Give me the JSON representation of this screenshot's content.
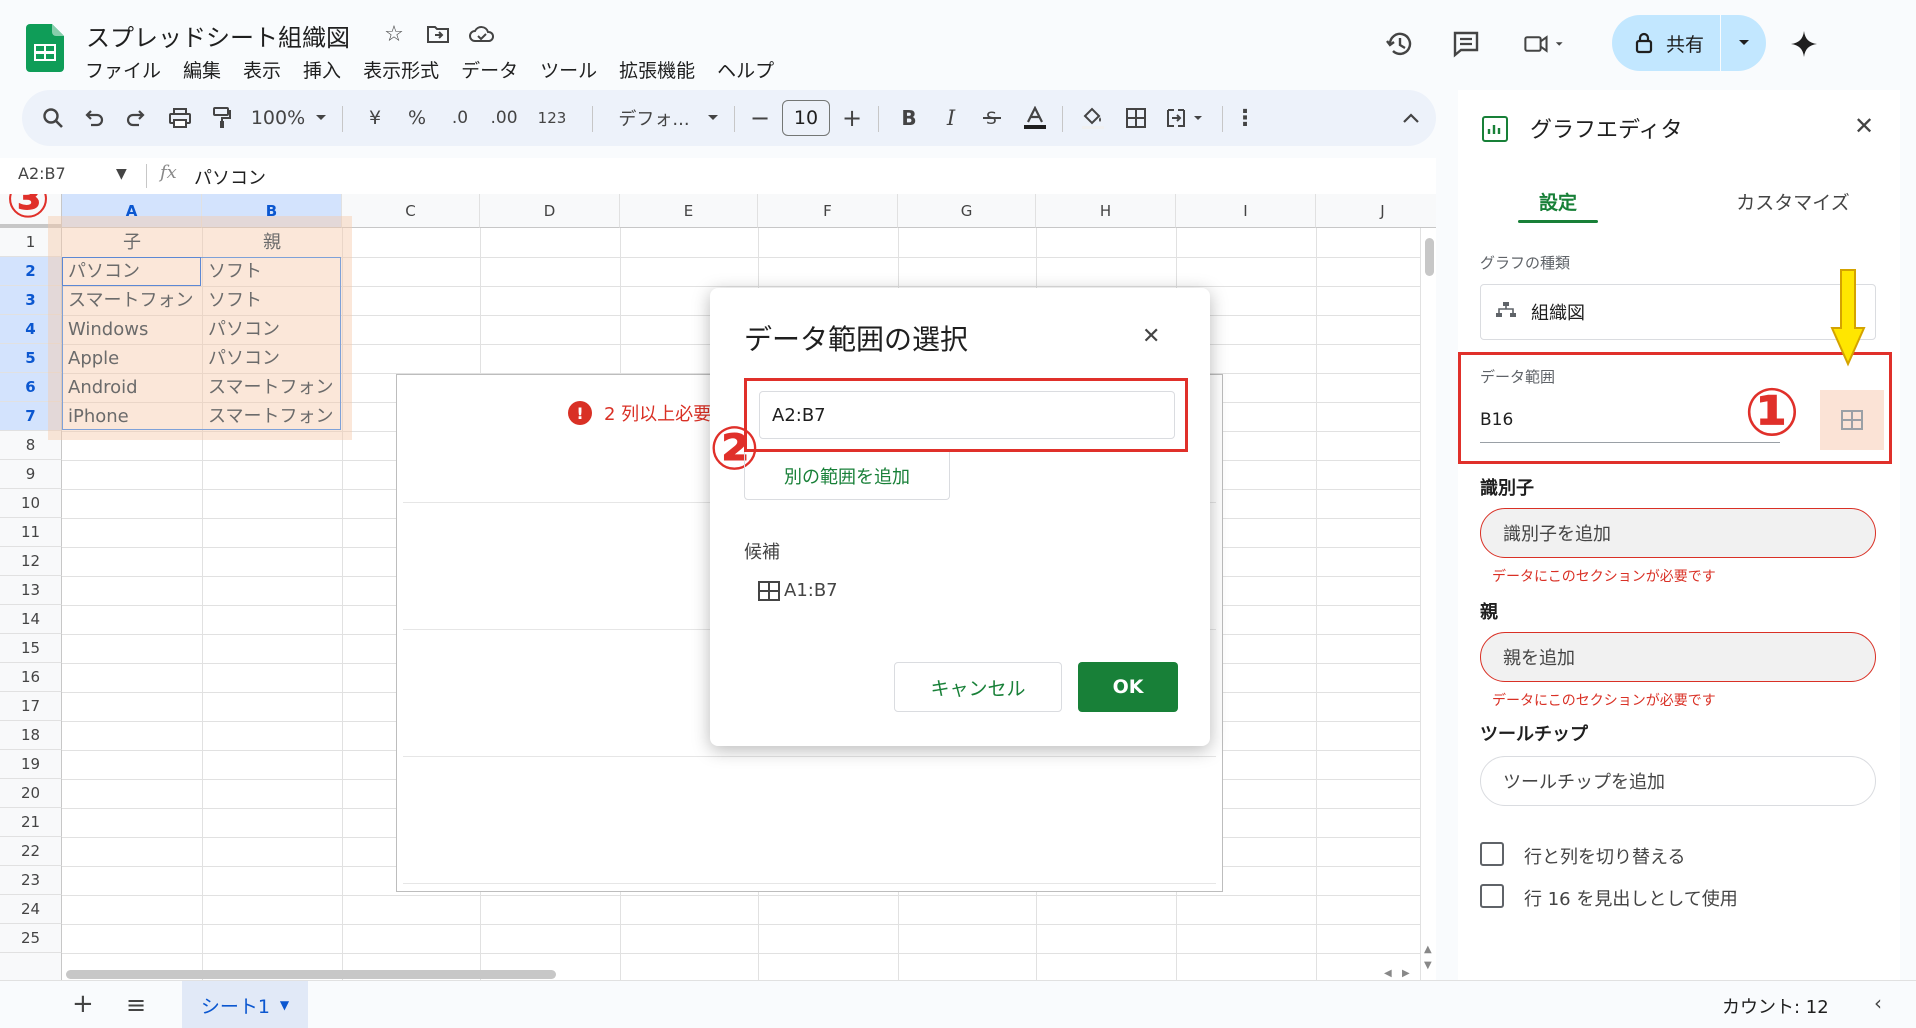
{
  "doc": {
    "title": "スプレッドシート組織図",
    "menu": [
      "ファイル",
      "編集",
      "表示",
      "挿入",
      "表示形式",
      "データ",
      "ツール",
      "拡張機能",
      "ヘルプ"
    ],
    "share_label": "共有"
  },
  "toolbar": {
    "zoom": "100%",
    "currency": "¥",
    "percent": "%",
    "dec_decrease": ".0",
    "dec_increase": ".00",
    "number_format": "123",
    "font_name": "デフォ...",
    "font_size": "10",
    "bold": "B",
    "italic": "I"
  },
  "formula_bar": {
    "name_box": "A2:B7",
    "fx": "fx",
    "value": "パソコン"
  },
  "grid": {
    "columns": [
      "A",
      "B",
      "C",
      "D",
      "E",
      "F",
      "G",
      "H",
      "I",
      "J"
    ],
    "rows": [
      "1",
      "2",
      "3",
      "4",
      "5",
      "6",
      "7",
      "8",
      "9",
      "10",
      "11",
      "12",
      "13",
      "14",
      "15",
      "16",
      "17",
      "18",
      "19",
      "20",
      "21",
      "22",
      "23",
      "24",
      "25"
    ],
    "header_row": [
      "子",
      "親"
    ],
    "data_rows": [
      [
        "パソコン",
        "ソフト"
      ],
      [
        "スマートフォン",
        "ソフト"
      ],
      [
        "Windows",
        "パソコン"
      ],
      [
        "Apple",
        "パソコン"
      ],
      [
        "Android",
        "スマートフォン"
      ],
      [
        "iPhone",
        "スマートフォン"
      ]
    ],
    "chart_error": "2 列以上必要"
  },
  "annotations": {
    "circle_1": "①",
    "circle_2": "②",
    "circle_3": "③"
  },
  "bottom": {
    "sheet_tab": "シート1",
    "count": "カウント: 12"
  },
  "chart_editor": {
    "title": "グラフエディタ",
    "tab_setup": "設定",
    "tab_customize": "カスタマイズ",
    "chart_type_label": "グラフの種類",
    "chart_type_value": "組織図",
    "data_range_label": "データ範囲",
    "data_range_value": "B16",
    "id_label": "識別子",
    "id_placeholder": "識別子を追加",
    "id_error": "データにこのセクションが必要です",
    "parent_label": "親",
    "parent_placeholder": "親を追加",
    "parent_error": "データにこのセクションが必要です",
    "tooltip_label": "ツールチップ",
    "tooltip_placeholder": "ツールチップを追加",
    "switch_rows_cols": "行と列を切り替える",
    "use_row_header": "行 16 を見出しとして使用"
  },
  "dialog": {
    "title": "データ範囲の選択",
    "input_value": "A2:B7",
    "add_range": "別の範囲を追加",
    "suggest_label": "候補",
    "suggest_item": "A1:B7",
    "cancel": "キャンセル",
    "ok": "OK"
  },
  "colors": {
    "accent_green": "#188038",
    "error_red": "#d93025",
    "annotation_red": "#e0302a",
    "share_blue": "#c2e7ff",
    "range_fill": "#f7c9aa"
  }
}
